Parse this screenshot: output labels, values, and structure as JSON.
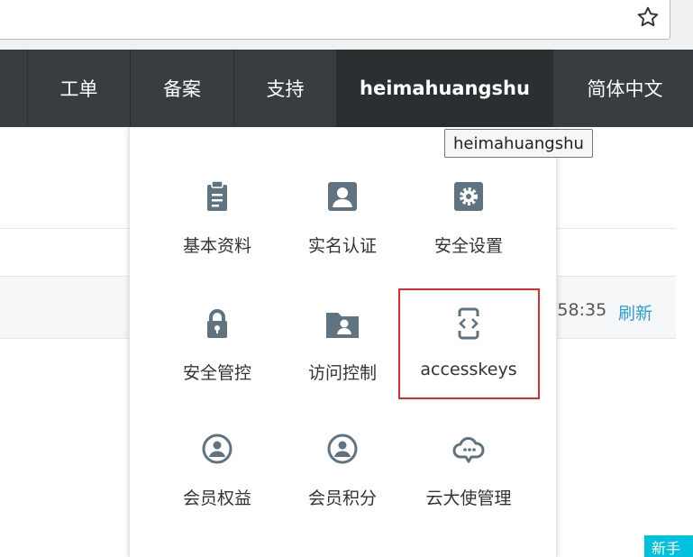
{
  "nav": {
    "items": [
      "工单",
      "备案",
      "支持"
    ],
    "user": "heimahuangshu",
    "language": "简体中文"
  },
  "tooltip": "heimahuangshu",
  "background": {
    "time_fragment": ":58:35",
    "refresh": "刷新",
    "newbie": "新手"
  },
  "menu": {
    "items": [
      {
        "label": "基本资料",
        "icon": "clipboard-icon"
      },
      {
        "label": "实名认证",
        "icon": "id-card-icon"
      },
      {
        "label": "安全设置",
        "icon": "gear-icon"
      },
      {
        "label": "安全管控",
        "icon": "lock-icon"
      },
      {
        "label": "访问控制",
        "icon": "folder-user-icon"
      },
      {
        "label": "accesskeys",
        "icon": "code-key-icon"
      },
      {
        "label": "会员权益",
        "icon": "member-icon"
      },
      {
        "label": "会员积分",
        "icon": "member-points-icon"
      },
      {
        "label": "云大使管理",
        "icon": "cloud-ambassador-icon"
      }
    ]
  },
  "colors": {
    "nav_bg": "#373d41",
    "icon": "#5f7381",
    "highlight": "#e22b2b",
    "link": "#2a9fd8",
    "badge": "#00c1de"
  }
}
